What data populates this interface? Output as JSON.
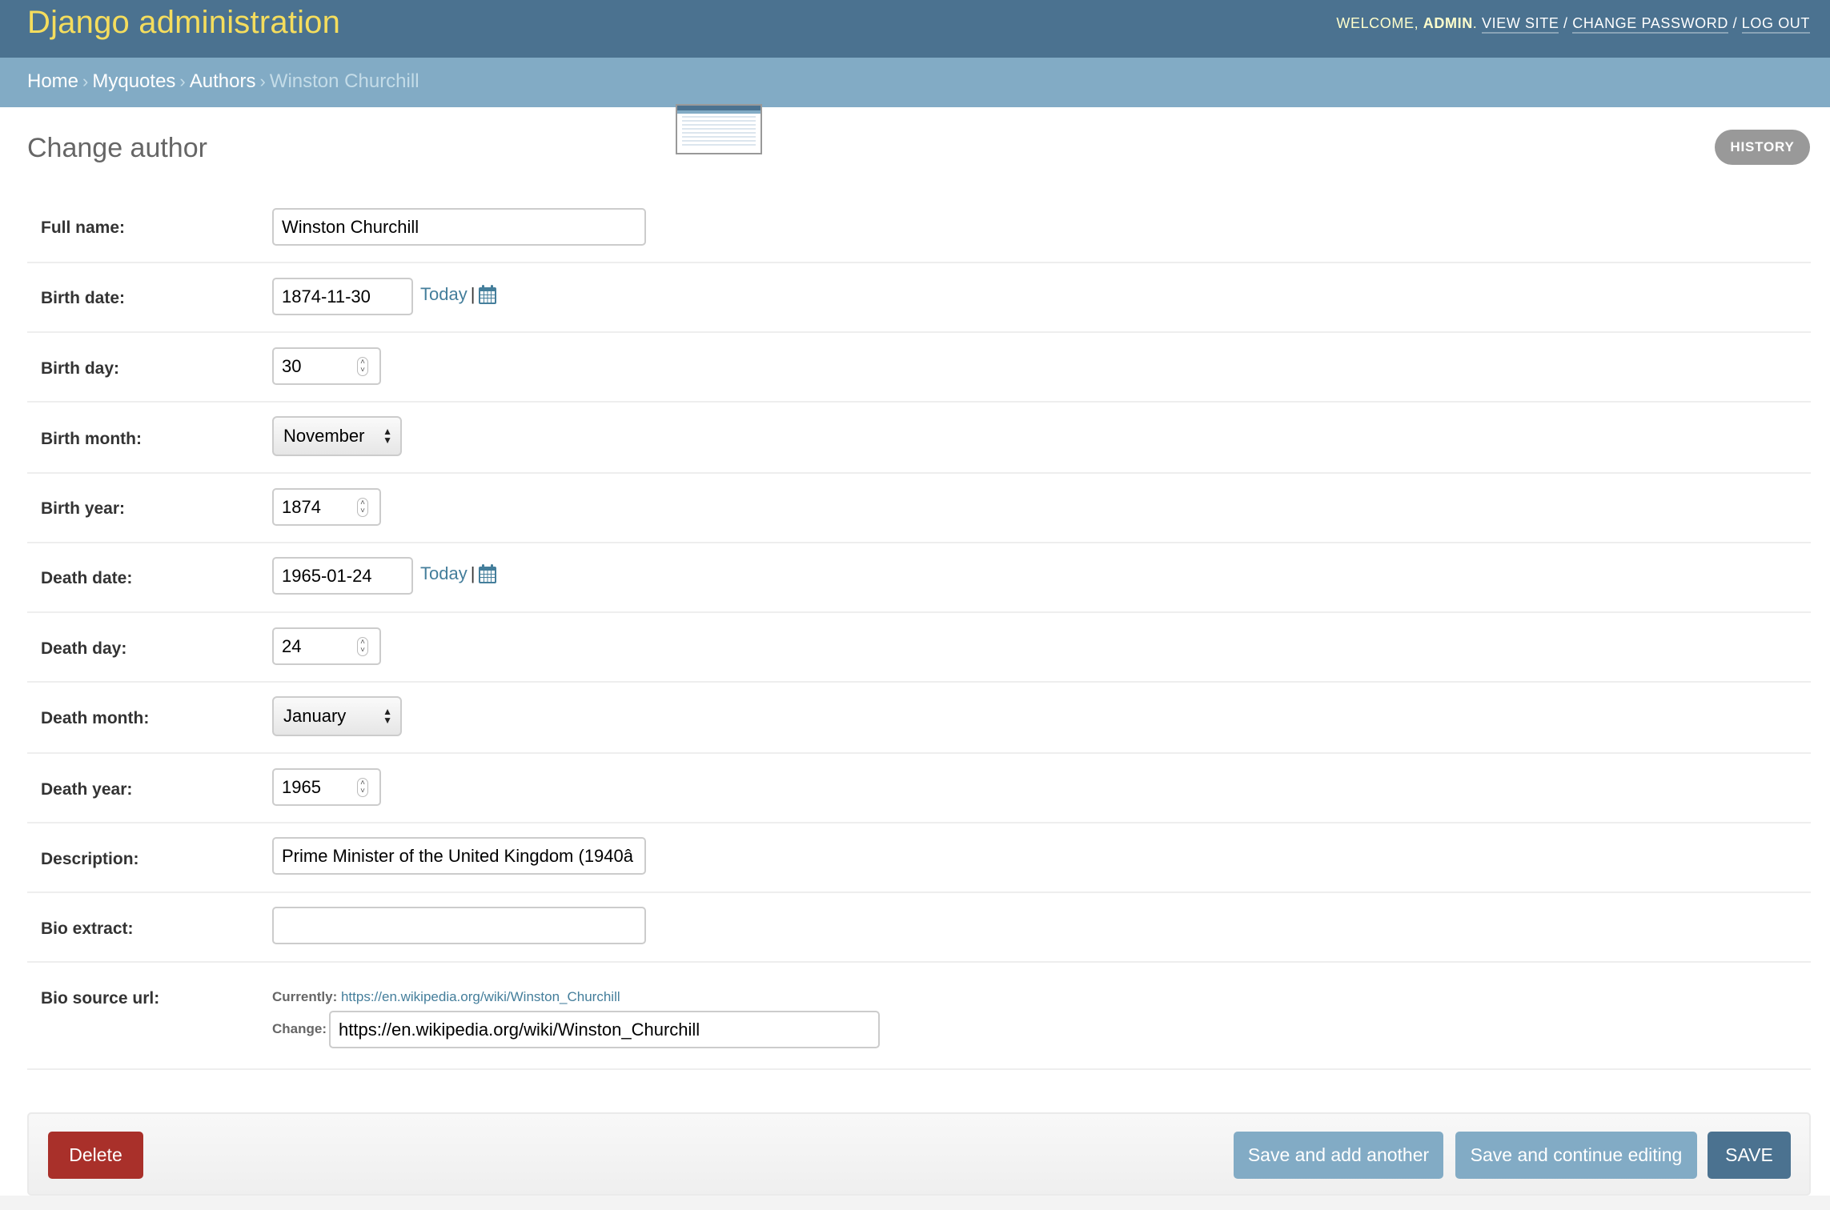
{
  "header": {
    "site_title": "Django administration",
    "welcome_prefix": "Welcome, ",
    "username": "admin",
    "welcome_suffix": ".",
    "view_site": "View site",
    "change_password": "Change password",
    "log_out": "Log out",
    "separator": "/"
  },
  "breadcrumbs": {
    "items": [
      "Home",
      "Myquotes",
      "Authors"
    ],
    "current": "Winston Churchill",
    "arrow": "›"
  },
  "page": {
    "title": "Change author",
    "history_label": "History"
  },
  "form": {
    "full_name": {
      "label": "Full name:",
      "value": "Winston Churchill"
    },
    "birth_date": {
      "label": "Birth date:",
      "value": "1874-11-30",
      "today_label": "Today",
      "sep": "|"
    },
    "birth_day": {
      "label": "Birth day:",
      "value": "30"
    },
    "birth_month": {
      "label": "Birth month:",
      "value": "November"
    },
    "birth_year": {
      "label": "Birth year:",
      "value": "1874"
    },
    "death_date": {
      "label": "Death date:",
      "value": "1965-01-24",
      "today_label": "Today",
      "sep": "|"
    },
    "death_day": {
      "label": "Death day:",
      "value": "24"
    },
    "death_month": {
      "label": "Death month:",
      "value": "January"
    },
    "death_year": {
      "label": "Death year:",
      "value": "1965"
    },
    "description": {
      "label": "Description:",
      "value": "Prime Minister of the United Kingdom (1940â"
    },
    "bio_extract": {
      "label": "Bio extract:",
      "value": ""
    },
    "bio_source_url": {
      "label": "Bio source url:",
      "currently_label": "Currently:",
      "currently_value": "https://en.wikipedia.org/wiki/Winston_Churchill",
      "change_label": "Change:",
      "value": "https://en.wikipedia.org/wiki/Winston_Churchill"
    }
  },
  "submit_row": {
    "delete": "Delete",
    "save_add_another": "Save and add another",
    "save_continue": "Save and continue editing",
    "save": "Save"
  },
  "colors": {
    "header_bg": "#4b7290",
    "breadcrumb_bg": "#82abc5",
    "branding": "#f5dd5d",
    "link": "#447e9b",
    "delete": "#a9302a",
    "history": "#999999"
  }
}
